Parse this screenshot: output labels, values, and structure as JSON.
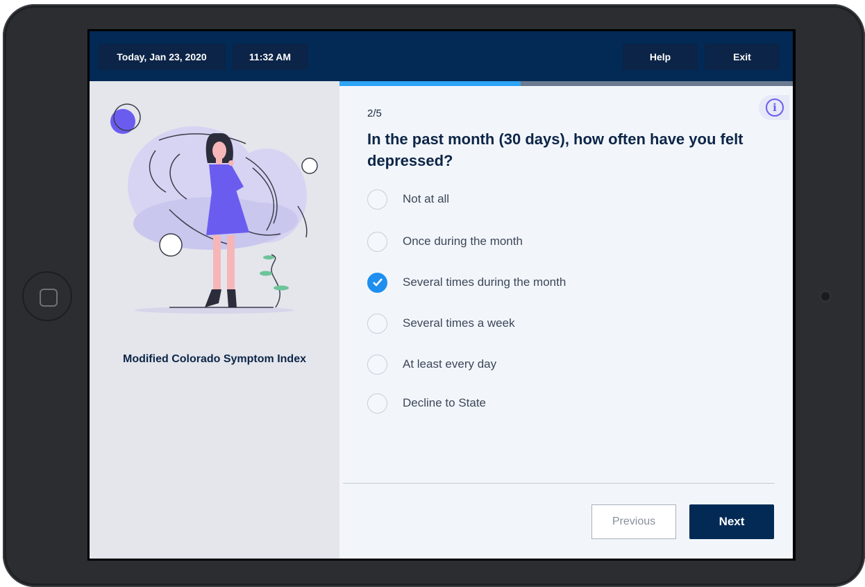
{
  "header": {
    "date": "Today,  Jan 23, 2020",
    "time": "11:32 AM",
    "help_label": "Help",
    "exit_label": "Exit"
  },
  "progress": {
    "current": 2,
    "total": 5,
    "fraction": 0.4
  },
  "survey": {
    "title": "Modified Colorado Symptom Index"
  },
  "question": {
    "counter": "2/5",
    "text": "In the past month (30 days), how often have you felt depressed?"
  },
  "options": [
    {
      "label": "Not at all",
      "selected": false
    },
    {
      "label": "Once during the month",
      "selected": false
    },
    {
      "label": "Several times during the month",
      "selected": true
    },
    {
      "label": "Several times a week",
      "selected": false
    },
    {
      "label": "At least every day",
      "selected": false
    },
    {
      "label": "Decline to State",
      "selected": false
    }
  ],
  "nav": {
    "previous_label": "Previous",
    "next_label": "Next"
  },
  "colors": {
    "header_bg": "#032a55",
    "accent_blue": "#1f8fef",
    "progress_fill": "#2ea4f5",
    "illustration_purple": "#6b5cf0"
  },
  "icons": {
    "info": "info-icon",
    "check": "check-icon",
    "home": "home-button-icon"
  }
}
